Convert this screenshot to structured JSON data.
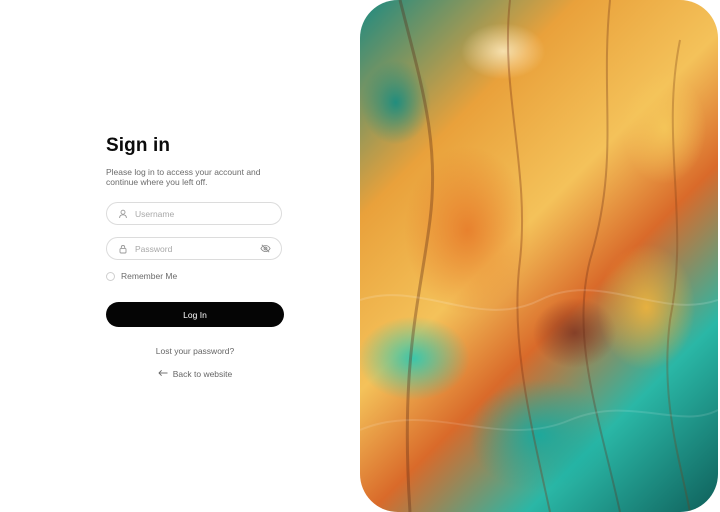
{
  "signin": {
    "title": "Sign in",
    "subtitle": "Please log in to access your account and continue where you left off.",
    "username": {
      "placeholder": "Username",
      "icon": "user-icon"
    },
    "password": {
      "placeholder": "Password",
      "icon": "lock-icon",
      "toggle_icon": "eye-off-icon"
    },
    "remember_label": "Remember Me",
    "login_label": "Log In",
    "lost_password": "Lost your password?",
    "back_label": "Back to website",
    "back_icon": "arrow-left-icon"
  },
  "colors": {
    "primary_button": "#050505",
    "border": "#dcdcdc",
    "muted_text": "#6b6b6b"
  }
}
